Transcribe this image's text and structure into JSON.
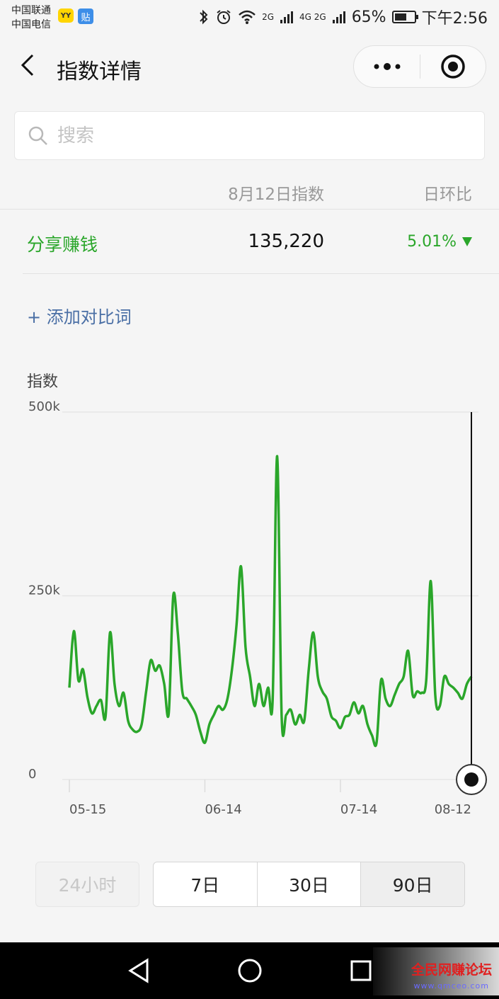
{
  "status": {
    "carrier1": "中国联通",
    "carrier2": "中国电信",
    "badge_yy": "YY",
    "badge_tie": "贴",
    "sig_label": "2G",
    "sig_label2": "4G 2G",
    "battery": "65%",
    "battery_level": 0.65,
    "time": "下午2:56"
  },
  "nav": {
    "title": "指数详情"
  },
  "search": {
    "placeholder": "搜索",
    "value": ""
  },
  "table": {
    "header_date": "8月12日指数",
    "header_ratio": "日环比",
    "row": {
      "keyword": "分享赚钱",
      "value": "135,220",
      "change": "5.01%"
    }
  },
  "add_compare": "+ 添加对比词",
  "colors": {
    "accent": "#2aa62a",
    "link": "#4a6fa5"
  },
  "chart_data": {
    "type": "line",
    "ylabel": "指数",
    "ylim": [
      0,
      500000
    ],
    "y_ticks": [
      "500k",
      "250k",
      "0"
    ],
    "y_tick_values": [
      500000,
      250000,
      0
    ],
    "x_tick_labels": [
      "05-15",
      "06-14",
      "07-14",
      "08-12"
    ],
    "x_tick_index": [
      0,
      30,
      60,
      89
    ],
    "series": [
      {
        "color": "#2aa62a",
        "values": [
          125000,
          202000,
          135000,
          150000,
          112000,
          90000,
          100000,
          108000,
          85000,
          200000,
          130000,
          100000,
          118000,
          80000,
          68000,
          65000,
          75000,
          120000,
          162000,
          148000,
          155000,
          130000,
          90000,
          250000,
          200000,
          120000,
          110000,
          100000,
          88000,
          65000,
          50000,
          75000,
          88000,
          100000,
          95000,
          110000,
          150000,
          210000,
          290000,
          180000,
          140000,
          100000,
          130000,
          100000,
          125000,
          108000,
          440000,
          85000,
          88000,
          95000,
          75000,
          88000,
          80000,
          150000,
          200000,
          140000,
          120000,
          110000,
          86000,
          80000,
          70000,
          85000,
          88000,
          105000,
          90000,
          100000,
          75000,
          60000,
          50000,
          135000,
          110000,
          100000,
          115000,
          130000,
          140000,
          175000,
          115000,
          120000,
          118000,
          135000,
          270000,
          115000,
          100000,
          140000,
          130000,
          125000,
          118000,
          110000,
          130000,
          140000
        ]
      }
    ],
    "grid": true,
    "legend": "none"
  }
}
